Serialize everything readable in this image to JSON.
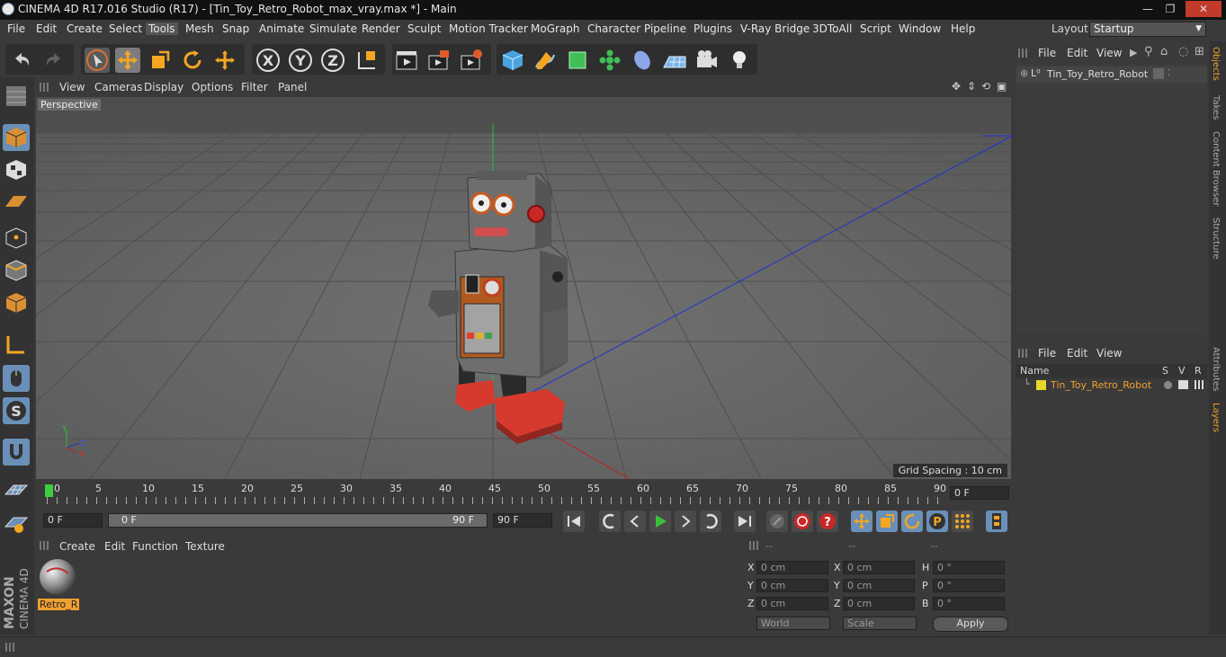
{
  "window": {
    "title": "CINEMA 4D R17.016 Studio (R17) - [Tin_Toy_Retro_Robot_max_vray.max *] - Main",
    "min_glyph": "—",
    "max_glyph": "❐",
    "close_glyph": "✕"
  },
  "menu": {
    "items": [
      "File",
      "Edit",
      "Create",
      "Select",
      "Tools",
      "Mesh",
      "Snap",
      "Animate",
      "Simulate",
      "Render",
      "Sculpt",
      "Motion Tracker",
      "MoGraph",
      "Character",
      "Pipeline",
      "Plugins",
      "V-Ray Bridge",
      "3DToAll",
      "Script",
      "Window",
      "Help"
    ],
    "active": "Tools",
    "layout_label": "Layout:",
    "layout_value": "Startup"
  },
  "toolbar": {
    "icons": [
      "undo-icon",
      "redo-icon",
      "select-arrow-icon",
      "move-icon",
      "scale-icon",
      "rotate-icon",
      "transform-icon",
      "x-axis-icon",
      "y-axis-icon",
      "z-axis-icon",
      "coordinate-system-icon",
      "render-view-icon",
      "render-picture-viewer-icon",
      "render-settings-icon",
      "cube-primitive-icon",
      "pen-spline-icon",
      "subdivision-icon",
      "cloner-icon",
      "deformer-icon",
      "floor-icon",
      "camera-icon",
      "light-icon"
    ]
  },
  "viewport": {
    "menu": [
      "View",
      "Cameras",
      "Display",
      "Options",
      "Filter",
      "Panel"
    ],
    "label": "Perspective",
    "grid_spacing": "Grid Spacing : 10 cm"
  },
  "timeline": {
    "ticks": [
      "0",
      "5",
      "10",
      "15",
      "20",
      "25",
      "30",
      "35",
      "40",
      "45",
      "50",
      "55",
      "60",
      "65",
      "70",
      "75",
      "80",
      "85",
      "90"
    ],
    "current_frame": "0 F",
    "start_field": "0 F",
    "range_start": "0 F",
    "range_end": "90 F",
    "end_field": "90 F"
  },
  "materials": {
    "menu": [
      "Create",
      "Edit",
      "Function",
      "Texture"
    ],
    "items": [
      {
        "name": "Retro_R"
      }
    ]
  },
  "coords": {
    "headers": [
      "--",
      "--",
      "--"
    ],
    "rows": [
      {
        "a": "X",
        "av": "0 cm",
        "b": "X",
        "bv": "0 cm",
        "c": "H",
        "cv": "0 °"
      },
      {
        "a": "Y",
        "av": "0 cm",
        "b": "Y",
        "bv": "0 cm",
        "c": "P",
        "cv": "0 °"
      },
      {
        "a": "Z",
        "av": "0 cm",
        "b": "Z",
        "bv": "0 cm",
        "c": "B",
        "cv": "0 °"
      }
    ],
    "mode": "World",
    "scale": "Scale",
    "apply": "Apply"
  },
  "objects": {
    "menu": [
      "File",
      "Edit",
      "View"
    ],
    "items": [
      {
        "name": "Tin_Toy_Retro_Robot"
      }
    ]
  },
  "layers": {
    "menu": [
      "File",
      "Edit",
      "View"
    ],
    "columns": {
      "name": "Name",
      "s": "S",
      "v": "V",
      "r": "R"
    },
    "items": [
      {
        "name": "Tin_Toy_Retro_Robot",
        "color": "#e8d82a"
      }
    ]
  },
  "side_tabs": {
    "top": [
      "Objects",
      "Takes",
      "Content Browser",
      "Structure"
    ],
    "bottom": [
      "Attributes",
      "Layers"
    ],
    "active_top": "Objects",
    "active_bottom": "Layers"
  },
  "brand": {
    "maxon": "MAXON",
    "product": "CINEMA 4D"
  },
  "colors": {
    "accent": "#f0a030",
    "highlight": "#6a8fb8",
    "play": "#39c239"
  }
}
